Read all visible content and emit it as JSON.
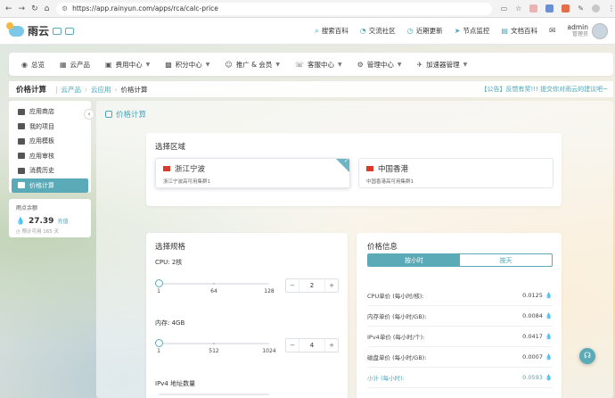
{
  "browser": {
    "url": "https://app.rainyun.com/apps/rca/calc-price"
  },
  "header": {
    "brand": "雨云",
    "links": [
      {
        "icon": "search-icon",
        "label": "搜索百科"
      },
      {
        "icon": "chat-icon",
        "label": "交流社区"
      },
      {
        "icon": "clock-icon",
        "label": "近期更新"
      },
      {
        "icon": "send-icon",
        "label": "节点监控"
      },
      {
        "icon": "book-icon",
        "label": "文档百科"
      }
    ],
    "user": {
      "name": "admin",
      "role": "管理员"
    }
  },
  "mainnav": [
    {
      "icon": "dashboard-icon",
      "label": "总览",
      "dropdown": false
    },
    {
      "icon": "grid-icon",
      "label": "云产品",
      "dropdown": false
    },
    {
      "icon": "wallet-icon",
      "label": "费用中心",
      "dropdown": true
    },
    {
      "icon": "gift-icon",
      "label": "积分中心",
      "dropdown": true
    },
    {
      "icon": "user-icon",
      "label": "推广 & 会员",
      "dropdown": true
    },
    {
      "icon": "headset-icon",
      "label": "客服中心",
      "dropdown": true
    },
    {
      "icon": "gear-icon",
      "label": "管理中心",
      "dropdown": true
    },
    {
      "icon": "rocket-icon",
      "label": "加速器管理",
      "dropdown": true
    }
  ],
  "breadcrumb": {
    "page_title": "价格计算",
    "items": [
      "云产品",
      "云应用",
      "价格计算"
    ],
    "notice": "【公告】反馈有奖!!! 提交你对雨云的建议吧~"
  },
  "sidebar": {
    "items": [
      {
        "label": "应用商店",
        "active": false
      },
      {
        "label": "我的项目",
        "active": false
      },
      {
        "label": "应用模板",
        "active": false
      },
      {
        "label": "应用审核",
        "active": false
      },
      {
        "label": "消费历史",
        "active": false
      },
      {
        "label": "价格计算",
        "active": true
      }
    ]
  },
  "balance": {
    "label": "雨点余额",
    "amount": "27.39",
    "recharge": "充值",
    "estimate": "预计可用 165 天"
  },
  "content": {
    "title": "价格计算",
    "region_title": "选择区域",
    "regions": [
      {
        "name": "浙江宁波",
        "desc": "浙江宁波高可用集群1",
        "selected": true
      },
      {
        "name": "中国香港",
        "desc": "中国香港高可用集群1",
        "selected": false
      }
    ],
    "spec_title": "选择规格",
    "cpu": {
      "label": "CPU: 2核",
      "ticks": [
        "1",
        "64",
        "128"
      ],
      "value": "2",
      "fraction": 0.008
    },
    "mem": {
      "label": "内存: 4GB",
      "ticks": [
        "1",
        "512",
        "1024"
      ],
      "value": "4",
      "fraction": 0.003
    },
    "ipv4": {
      "label": "IPv4 地址数量"
    },
    "price_title": "价格信息",
    "tabs": [
      {
        "label": "按小时",
        "active": true
      },
      {
        "label": "按天",
        "active": false
      }
    ],
    "prices": [
      {
        "label": "CPU单价 (每小时/核):",
        "value": "0.0125"
      },
      {
        "label": "内存单价 (每小时/GB):",
        "value": "0.0084"
      },
      {
        "label": "IPv4单价 (每小时/个):",
        "value": "0.0417"
      },
      {
        "label": "磁盘单价 (每小时/GB):",
        "value": "0.0007"
      },
      {
        "label": "小计 (每小时):",
        "value": "0.0593"
      }
    ]
  }
}
